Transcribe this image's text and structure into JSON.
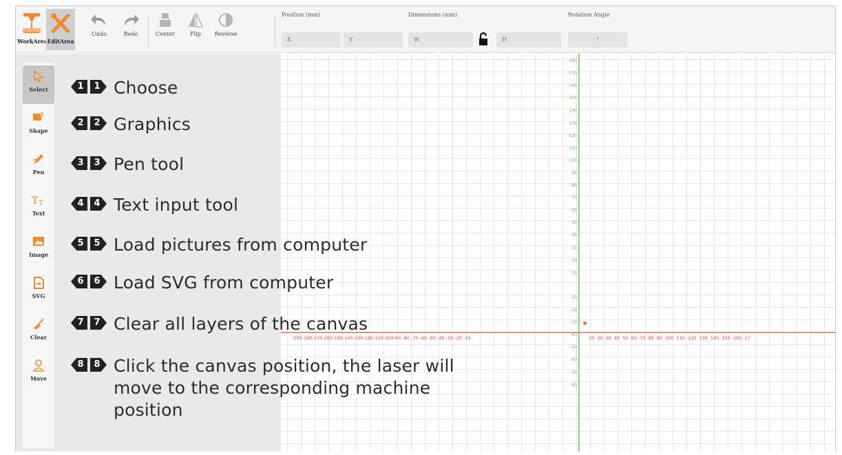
{
  "toolbar": {
    "workarea": "WorkArea",
    "editarea": "EditArea",
    "undo": "Undo",
    "redo": "Redo",
    "center": "Center",
    "flip": "Flip",
    "reverse": "Reverse",
    "position_title": "Position (mm)",
    "position_x": "X",
    "position_y": "Y",
    "dimensions_title": "Dimensions (mm)",
    "dimensions_w": "W",
    "dimensions_h": "H",
    "rotation_title": "Rotation Angle",
    "rotation_value": "°"
  },
  "sidebar": {
    "items": [
      {
        "label": "Select",
        "icon": "cursor-icon"
      },
      {
        "label": "Shape",
        "icon": "shape-icon"
      },
      {
        "label": "Pen",
        "icon": "pen-icon"
      },
      {
        "label": "Text",
        "icon": "text-icon"
      },
      {
        "label": "Image",
        "icon": "image-icon"
      },
      {
        "label": "SVG",
        "icon": "svg-file-icon"
      },
      {
        "label": "Clear",
        "icon": "broom-icon"
      },
      {
        "label": "Move",
        "icon": "person-move-icon"
      }
    ]
  },
  "callouts": [
    {
      "n": "1",
      "text": "Choose"
    },
    {
      "n": "2",
      "text": "Graphics"
    },
    {
      "n": "3",
      "text": "Pen tool"
    },
    {
      "n": "4",
      "text": "Text input tool"
    },
    {
      "n": "5",
      "text": "Load pictures from computer"
    },
    {
      "n": "6",
      "text": "Load SVG from computer"
    },
    {
      "n": "7",
      "text": "Clear all layers of the canvas"
    },
    {
      "n": "8",
      "text": "Click the canvas position, the laser will move to the corresponding machine position"
    }
  ],
  "canvas": {
    "y_ticks": [
      "180",
      "170",
      "160",
      "150",
      "140",
      "130",
      "120",
      "110",
      "100",
      "90",
      "80",
      "70",
      "60",
      "50",
      "40",
      "30",
      "20",
      "10",
      "-10",
      "-20",
      "-30",
      "-40",
      "-50",
      "-60",
      "-70",
      "-80"
    ],
    "x_ticks_left": "-190-180-170-160-150-140-130-120-110-100-90 -80 -70 -60 -50 -40 -30 -20 -10",
    "x_ticks_right": "10 20 30 40 50 60 70 80 90 100 110 120 130 140 150 160 17",
    "colors": {
      "x_axis": "#ea4b3d",
      "y_axis": "#6cbd61",
      "accent": "#f28a2e"
    }
  }
}
